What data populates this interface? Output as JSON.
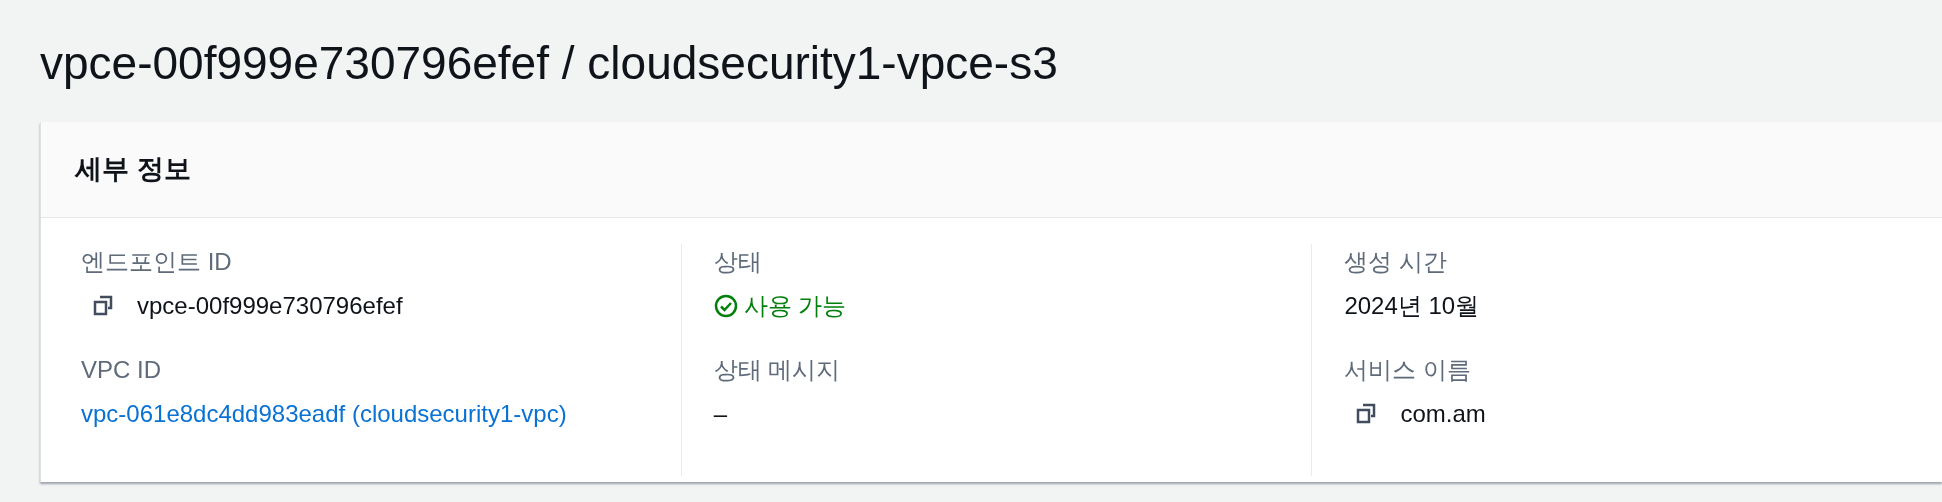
{
  "page_title": "vpce-00f999e730796efef / cloudsecurity1-vpce-s3",
  "panel": {
    "title": "세부 정보",
    "columns": [
      {
        "fields": [
          {
            "label": "엔드포인트 ID",
            "kind": "copy",
            "value": "vpce-00f999e730796efef"
          },
          {
            "label": "VPC ID",
            "kind": "link",
            "value": "vpc-061e8dc4dd983eadf (cloudsecurity1-vpc)"
          }
        ]
      },
      {
        "fields": [
          {
            "label": "상태",
            "kind": "status",
            "value": "사용 가능"
          },
          {
            "label": "상태 메시지",
            "kind": "text",
            "value": "–"
          }
        ]
      },
      {
        "fields": [
          {
            "label": "생성 시간",
            "kind": "text",
            "value": "2024년 10월"
          },
          {
            "label": "서비스 이름",
            "kind": "copy",
            "value": "com.am"
          }
        ]
      }
    ]
  }
}
